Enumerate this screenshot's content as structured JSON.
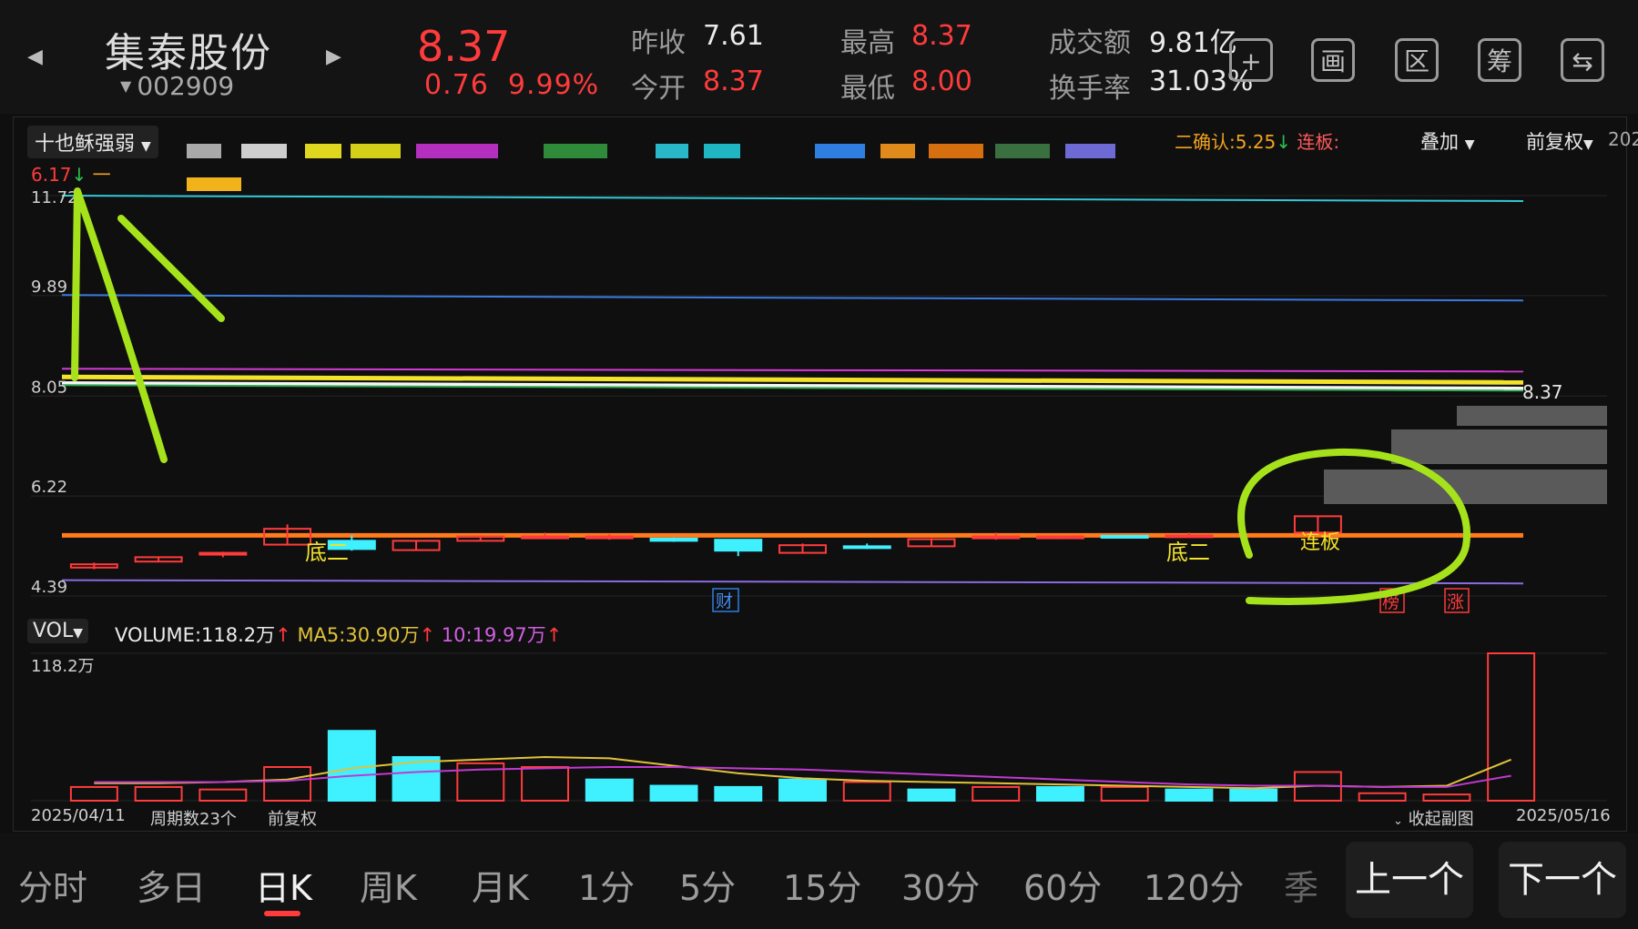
{
  "header": {
    "stock_name": "集泰股份",
    "stock_code": "002909",
    "price": "8.37",
    "change": "0.76",
    "change_pct": "9.99%",
    "prev_close_label": "昨收",
    "prev_close": "7.61",
    "open_label": "今开",
    "open": "8.37",
    "high_label": "最高",
    "high": "8.37",
    "low_label": "最低",
    "low": "8.00",
    "amount_label": "成交额",
    "amount": "9.81亿",
    "turnover_label": "换手率",
    "turnover": "31.03%",
    "icons": [
      "plus-icon",
      "draw-icon",
      "range-icon",
      "chip-icon",
      "switch-device-icon"
    ],
    "icon_glyphs": [
      "+",
      "画",
      "区",
      "筹",
      "⇆"
    ]
  },
  "main_chart": {
    "indicator_name": "十也稣强弱",
    "indicator_value": "6.17",
    "indicator_arrow": "↓",
    "indicator_dash": "一",
    "confirm_text": "二确认:5.25",
    "confirm_arrow": "↓",
    "lianban_label": "连板:",
    "overlay_label": "叠加",
    "adjust_label": "前复权",
    "right_cut": "202",
    "y_ticks": [
      "11.72",
      "9.89",
      "8.05",
      "6.22",
      "4.39"
    ],
    "last_price_label": "8.37",
    "annotations": {
      "bottom2_a": "底二",
      "bottom2_b": "底二",
      "lianban": "连板",
      "cai": "财",
      "bang": "榜",
      "zhang": "涨"
    }
  },
  "chart_data": {
    "type": "candlestick",
    "date_start": "2025/04/11",
    "date_end": "2025/05/16",
    "candles": [
      {
        "o": 4.97,
        "h": 5.0,
        "l": 4.88,
        "c": 4.91,
        "up": true
      },
      {
        "o": 5.02,
        "h": 5.1,
        "l": 5.02,
        "c": 5.1,
        "up": true
      },
      {
        "o": 5.15,
        "h": 5.2,
        "l": 5.1,
        "c": 5.18,
        "up": true
      },
      {
        "o": 5.33,
        "h": 5.7,
        "l": 5.33,
        "c": 5.62,
        "up": true
      },
      {
        "o": 5.4,
        "h": 5.5,
        "l": 5.22,
        "c": 5.25,
        "up": false
      },
      {
        "o": 5.23,
        "h": 5.4,
        "l": 5.22,
        "c": 5.4,
        "up": true
      },
      {
        "o": 5.4,
        "h": 5.5,
        "l": 5.4,
        "c": 5.48,
        "up": true
      },
      {
        "o": 5.48,
        "h": 5.55,
        "l": 5.45,
        "c": 5.48,
        "up": true
      },
      {
        "o": 5.48,
        "h": 5.52,
        "l": 5.42,
        "c": 5.47,
        "up": true
      },
      {
        "o": 5.44,
        "h": 5.46,
        "l": 5.38,
        "c": 5.4,
        "up": false
      },
      {
        "o": 5.42,
        "h": 5.42,
        "l": 5.12,
        "c": 5.22,
        "up": false
      },
      {
        "o": 5.18,
        "h": 5.35,
        "l": 5.18,
        "c": 5.32,
        "up": true
      },
      {
        "o": 5.3,
        "h": 5.35,
        "l": 5.25,
        "c": 5.28,
        "up": false
      },
      {
        "o": 5.3,
        "h": 5.45,
        "l": 5.3,
        "c": 5.43,
        "up": true
      },
      {
        "o": 5.48,
        "h": 5.55,
        "l": 5.42,
        "c": 5.48,
        "up": true
      },
      {
        "o": 5.46,
        "h": 5.48,
        "l": 5.43,
        "c": 5.48,
        "up": true
      },
      {
        "o": 5.49,
        "h": 5.5,
        "l": 5.46,
        "c": 5.47,
        "up": false
      },
      {
        "o": 5.5,
        "h": 5.55,
        "l": 5.48,
        "c": 5.5,
        "up": true
      },
      {
        "o": 5.55,
        "h": 5.85,
        "l": 5.55,
        "c": 5.85,
        "up": true
      }
    ],
    "levels": [
      {
        "name": "cyan",
        "y0": 11.72,
        "y1": 11.62,
        "color": "#33c9d6"
      },
      {
        "name": "blue",
        "y0": 9.9,
        "y1": 9.8,
        "color": "#3b7be0"
      },
      {
        "name": "magenta",
        "y0": 8.55,
        "y1": 8.5,
        "color": "#d63ad6"
      },
      {
        "name": "yellow",
        "y0": 8.4,
        "y1": 8.3,
        "color": "#f2e22a"
      },
      {
        "name": "white",
        "y0": 8.28,
        "y1": 8.18,
        "color": "#f5f5f5"
      },
      {
        "name": "green",
        "y0": 8.25,
        "y1": 8.15,
        "color": "#2fa84f"
      },
      {
        "name": "orange",
        "y0": 5.5,
        "y1": 5.5,
        "color": "#ff7b1c"
      },
      {
        "name": "purple",
        "y0": 4.68,
        "y1": 4.62,
        "color": "#8a6ce0"
      }
    ],
    "volume": {
      "label": "VOL",
      "volume_text": "VOLUME:118.2万",
      "ma5_text": "MA5:30.90万",
      "ma10_text": "10:19.97万",
      "y_top_label": "118.2万",
      "bars": [
        11,
        11,
        9,
        27,
        56,
        35,
        30,
        27,
        17,
        12,
        11,
        17,
        15,
        9,
        11,
        11,
        11,
        9,
        9,
        23,
        6,
        5,
        118.2
      ],
      "bar_up": [
        true,
        true,
        true,
        true,
        false,
        false,
        true,
        true,
        false,
        false,
        false,
        false,
        true,
        false,
        true,
        false,
        true,
        false,
        false,
        true,
        true,
        true,
        true
      ],
      "ma5": [
        14,
        14,
        15,
        17,
        26,
        31,
        33,
        35,
        34,
        28,
        22,
        18,
        16,
        15,
        14,
        13,
        12,
        11,
        10,
        12,
        11,
        12,
        33
      ],
      "ma10": [
        15,
        15,
        15,
        16,
        20,
        23,
        25,
        26,
        27,
        27,
        26,
        25,
        23,
        21,
        19,
        17,
        15,
        13,
        12,
        12,
        11,
        11,
        20
      ]
    }
  },
  "footer": {
    "date_start": "2025/04/11",
    "period_count": "周期数23个",
    "adjust": "前复权",
    "collapse": "收起副图",
    "date_end": "2025/05/16"
  },
  "tabs": [
    "分时",
    "多日",
    "日K",
    "周K",
    "月K",
    "1分",
    "5分",
    "15分",
    "30分",
    "60分",
    "120分",
    "季"
  ],
  "active_tab": "日K",
  "nav": {
    "prev": "上一个",
    "next": "下一个"
  },
  "colors": {
    "up": "#ff3b3b",
    "down": "#3ff0ff",
    "ma5": "#e0c23a",
    "ma10": "#c03ad0",
    "highlight": "#a6e21b"
  }
}
